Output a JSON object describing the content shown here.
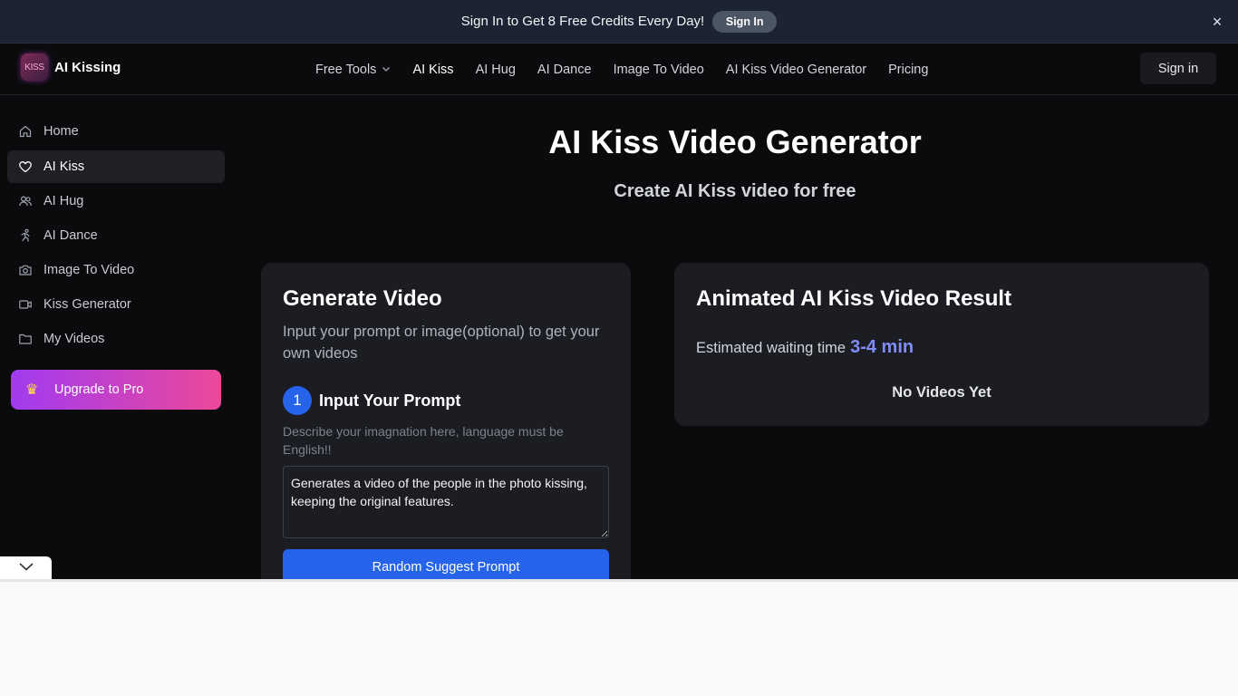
{
  "banner": {
    "text": "Sign In to Get 8 Free Credits Every Day!",
    "button": "Sign In",
    "close_icon": "×"
  },
  "header": {
    "logo_mark": "KISS",
    "logo_name": "AI Kissing",
    "nav": [
      {
        "label": "Free Tools",
        "has_dropdown": true
      },
      {
        "label": "AI Kiss",
        "active": true
      },
      {
        "label": "AI Hug"
      },
      {
        "label": "AI Dance"
      },
      {
        "label": "Image To Video"
      },
      {
        "label": "AI Kiss Video Generator"
      },
      {
        "label": "Pricing"
      }
    ],
    "signin": "Sign in"
  },
  "sidebar": {
    "items": [
      {
        "label": "Home",
        "icon": "home-icon"
      },
      {
        "label": "AI Kiss",
        "icon": "heart-icon",
        "active": true
      },
      {
        "label": "AI Hug",
        "icon": "users-icon"
      },
      {
        "label": "AI Dance",
        "icon": "person-running-icon"
      },
      {
        "label": "Image To Video",
        "icon": "camera-icon"
      },
      {
        "label": "Kiss Generator",
        "icon": "video-icon"
      },
      {
        "label": "My Videos",
        "icon": "folder-icon"
      }
    ],
    "upgrade": "Upgrade to Pro",
    "upgrade_icon": "♛"
  },
  "main": {
    "title": "AI Kiss Video Generator",
    "subtitle": "Create AI Kiss video for free",
    "generate": {
      "title": "Generate Video",
      "description": "Input your prompt or image(optional) to get your own videos",
      "step_number": "1",
      "step_label": "Input Your Prompt",
      "hint": "Describe your imagnation here, language must be English!!",
      "prompt_value": "Generates a video of the people in the photo kissing, keeping the original features.",
      "suggest_button": "Random Suggest Prompt"
    },
    "result": {
      "title": "Animated AI Kiss Video Result",
      "wait_label": "Estimated waiting time",
      "wait_value": "3-4 min",
      "empty": "No Videos Yet"
    }
  },
  "colors": {
    "accent_blue": "#2563eb",
    "wait_value": "#818cf8",
    "upgrade_gradient_start": "#a13bf0",
    "upgrade_gradient_end": "#ec4899"
  }
}
